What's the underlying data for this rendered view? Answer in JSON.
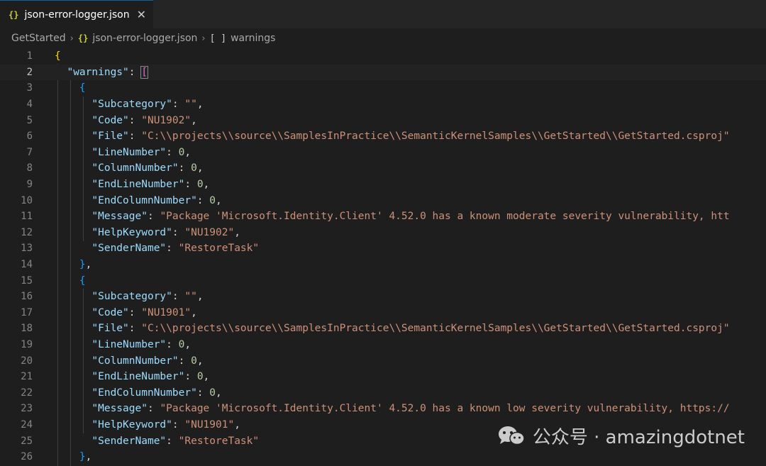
{
  "tab": {
    "title": "json-error-logger.json",
    "icon": "{}",
    "close": "✕"
  },
  "breadcrumb": {
    "folder": "GetStarted",
    "file": "json-error-logger.json",
    "symbol_icon": "[ ]",
    "symbol": "warnings"
  },
  "watermark": {
    "text": "公众号 · amazingdotnet"
  },
  "lines": [
    {
      "n": "1"
    },
    {
      "n": "2"
    },
    {
      "n": "3"
    },
    {
      "n": "4"
    },
    {
      "n": "5"
    },
    {
      "n": "6"
    },
    {
      "n": "7"
    },
    {
      "n": "8"
    },
    {
      "n": "9"
    },
    {
      "n": "10"
    },
    {
      "n": "11"
    },
    {
      "n": "12"
    },
    {
      "n": "13"
    },
    {
      "n": "14"
    },
    {
      "n": "15"
    },
    {
      "n": "16"
    },
    {
      "n": "17"
    },
    {
      "n": "18"
    },
    {
      "n": "19"
    },
    {
      "n": "20"
    },
    {
      "n": "21"
    },
    {
      "n": "22"
    },
    {
      "n": "23"
    },
    {
      "n": "24"
    },
    {
      "n": "25"
    },
    {
      "n": "26"
    }
  ],
  "code": {
    "l2_key": "\"warnings\"",
    "k_sub": "\"Subcategory\"",
    "k_code": "\"Code\"",
    "k_file": "\"File\"",
    "k_line": "\"LineNumber\"",
    "k_col": "\"ColumnNumber\"",
    "k_eline": "\"EndLineNumber\"",
    "k_ecol": "\"EndColumnNumber\"",
    "k_msg": "\"Message\"",
    "k_help": "\"HelpKeyword\"",
    "k_sender": "\"SenderName\"",
    "empty": "\"\"",
    "code1": "\"NU1902\"",
    "code2": "\"NU1901\"",
    "file": "\"C:\\\\projects\\\\source\\\\SamplesInPractice\\\\SemanticKernelSamples\\\\GetStarted\\\\GetStarted.csproj\"",
    "zero": "0",
    "msg1": "\"Package 'Microsoft.Identity.Client' 4.52.0 has a known moderate severity vulnerability, htt",
    "msg2": "\"Package 'Microsoft.Identity.Client' 4.52.0 has a known low severity vulnerability, https://",
    "sender": "\"RestoreTask\""
  }
}
